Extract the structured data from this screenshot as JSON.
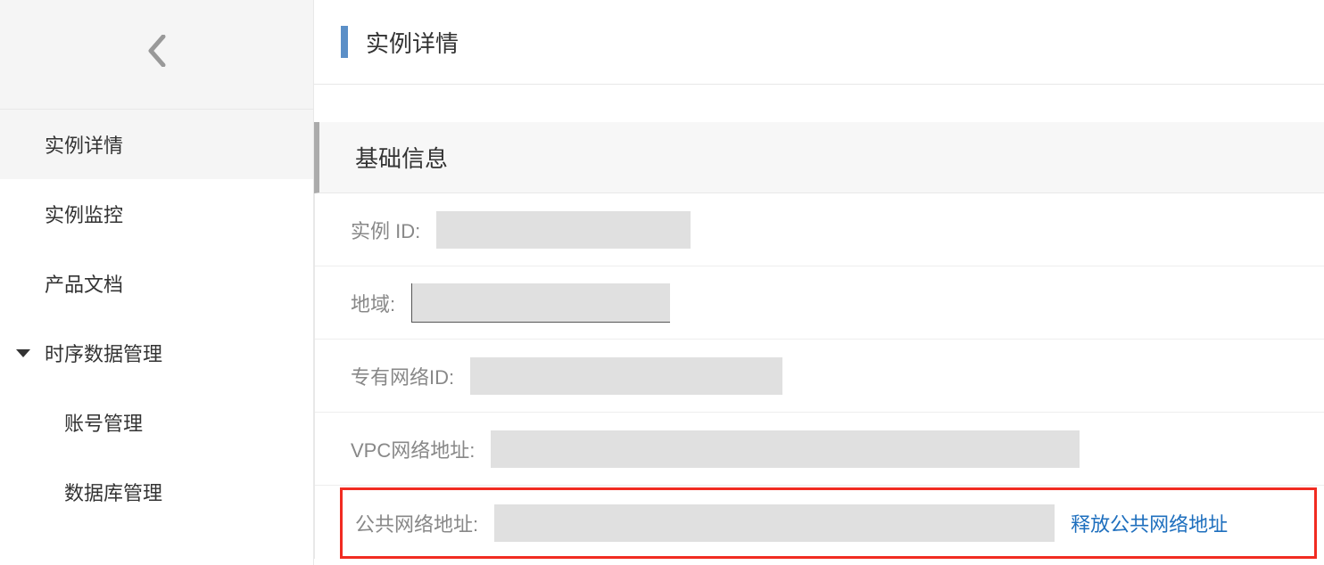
{
  "page": {
    "title": "实例详情"
  },
  "sidebar": {
    "items": [
      {
        "label": "实例详情"
      },
      {
        "label": "实例监控"
      },
      {
        "label": "产品文档"
      },
      {
        "label": "时序数据管理"
      },
      {
        "label": "账号管理"
      },
      {
        "label": "数据库管理"
      }
    ]
  },
  "section": {
    "title": "基础信息"
  },
  "info": {
    "instance_id_label": "实例 ID:",
    "region_label": "地域:",
    "vpc_id_label": "专有网络ID:",
    "vpc_addr_label": "VPC网络地址:",
    "public_addr_label": "公共网络地址:",
    "release_public_link": "释放公共网络地址"
  }
}
